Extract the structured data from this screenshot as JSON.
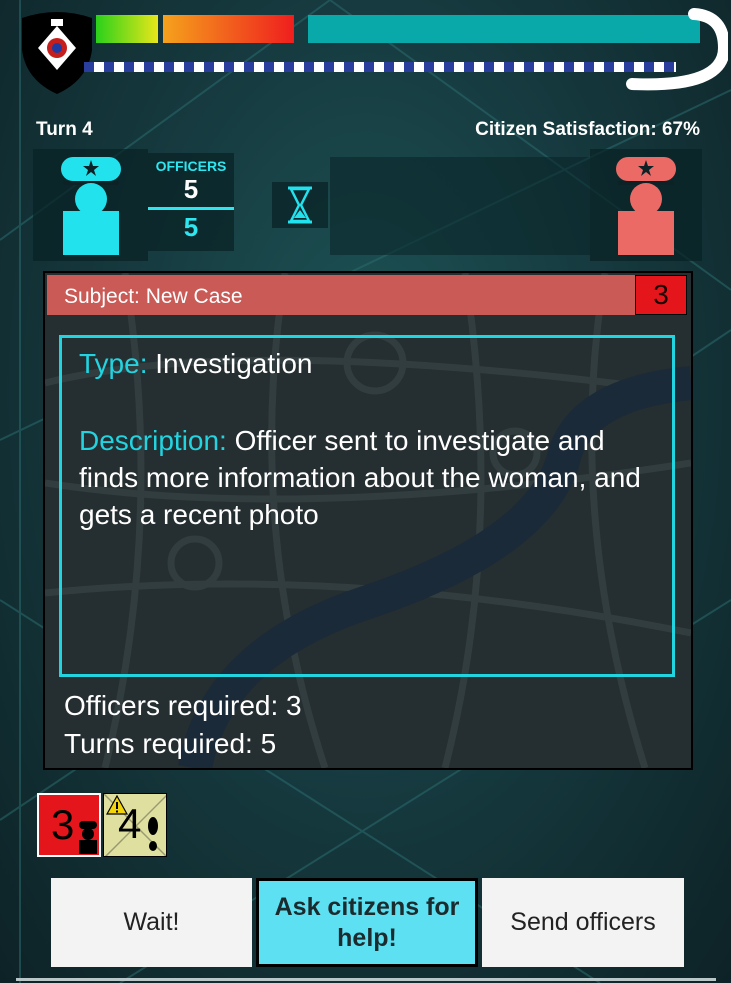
{
  "hud": {
    "turn_label": "Turn 4",
    "satisfaction_label": "Citizen Satisfaction: 67%",
    "colors": {
      "bar_green": "#2ad11a",
      "bar_red": "#ef1e1e",
      "bar_teal": "#0aa9a9",
      "accent": "#22d3e0"
    }
  },
  "officers": {
    "title": "OFFICERS",
    "available": "5",
    "total": "5"
  },
  "case": {
    "subject": "Subject: New Case",
    "tag_number": "3",
    "type_key": "Type:",
    "type_value": " Investigation",
    "desc_key": "Description:",
    "desc_value": " Officer sent to investigate and finds more information about the woman, and gets a recent photo",
    "officers_required": "Officers required: 3",
    "turns_required": "Turns required: 5"
  },
  "chips": [
    {
      "number": "3",
      "icon": "police-officer-icon",
      "color": "#e4161b"
    },
    {
      "number": "4",
      "icon": "footprints-icon",
      "warning_icon": "warning-icon",
      "color": "#dfe0a0"
    }
  ],
  "actions": {
    "wait": "Wait!",
    "ask": "Ask citizens for help!",
    "send": "Send officers"
  }
}
